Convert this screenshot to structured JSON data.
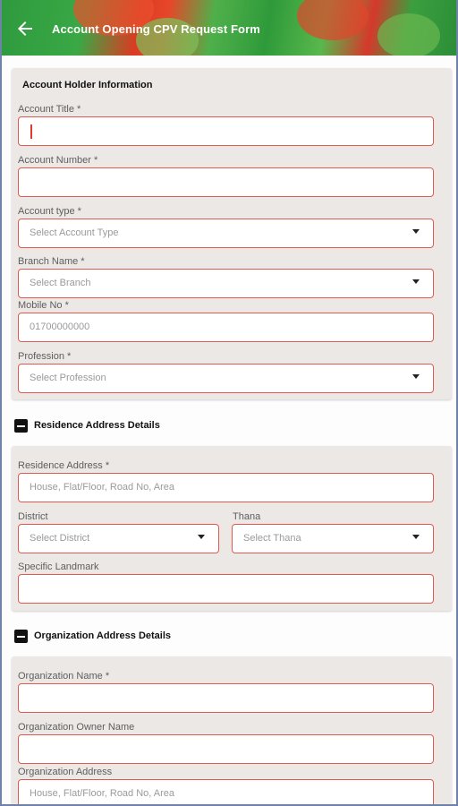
{
  "appbar": {
    "title": "Account Opening CPV Request Form",
    "back_icon": "arrow-back-icon"
  },
  "account_holder": {
    "title": "Account Holder Information",
    "account_title": {
      "label": "Account Title *",
      "value": ""
    },
    "account_number": {
      "label": "Account Number *",
      "value": ""
    },
    "account_type": {
      "label": "Account type *",
      "placeholder": "Select Account Type"
    },
    "branch_name": {
      "label": "Branch Name *",
      "placeholder": "Select Branch"
    },
    "mobile_no": {
      "label": "Mobile No *",
      "placeholder": "01700000000"
    },
    "profession": {
      "label": "Profession *",
      "placeholder": "Select Profession"
    }
  },
  "residence": {
    "title": "Residence Address Details",
    "toggle_icon": "minus-square-icon",
    "address": {
      "label": "Residence Address *",
      "placeholder": "House, Flat/Floor, Road No,  Area"
    },
    "district": {
      "label": "District",
      "placeholder": "Select District"
    },
    "thana": {
      "label": "Thana",
      "placeholder": "Select Thana"
    },
    "landmark": {
      "label": "Specific Landmark",
      "value": ""
    }
  },
  "organization": {
    "title": "Organization Address Details",
    "toggle_icon": "minus-square-icon",
    "name": {
      "label": "Organization Name *",
      "value": ""
    },
    "owner_name": {
      "label": "Organization Owner Name",
      "value": ""
    },
    "address": {
      "label": "Organization Address",
      "placeholder": "House, Flat/Floor, Road No,  Area"
    }
  },
  "colors": {
    "field_border": "#e05a4f",
    "card_bg": "#ebe8e6",
    "appbar_green": "#2e9a3e",
    "appbar_red": "#e8462a"
  }
}
